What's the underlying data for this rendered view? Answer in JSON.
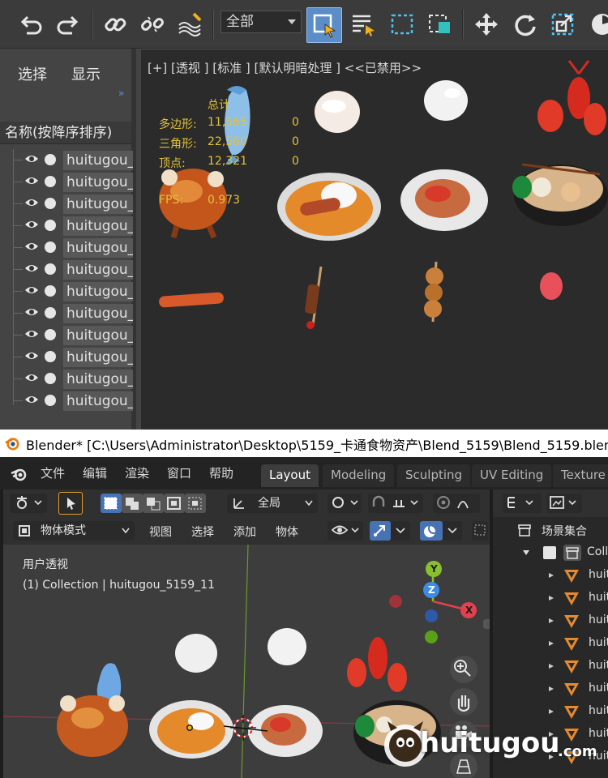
{
  "max": {
    "toolbar": {
      "scope_value": "全部"
    },
    "left_panel": {
      "menu_select": "选择",
      "menu_display": "显示",
      "collapse_glyph": "»",
      "column_header": "名称(按降序排序)",
      "items": [
        "huitugou_",
        "huitugou_",
        "huitugou_",
        "huitugou_",
        "huitugou_",
        "huitugou_",
        "huitugou_",
        "huitugou_",
        "huitugou_",
        "huitugou_",
        "huitugou_",
        "huitugou_"
      ]
    },
    "viewport": {
      "label": "[+] [透视 ] [标准 ] [默认明暗处理 ] <<已禁用>>",
      "stats": {
        "total_label": "总计",
        "polygons_label": "多边形:",
        "polygons_value": "11,565",
        "polygons_sel": "0",
        "triangles_label": "三角形:",
        "triangles_value": "22,560",
        "triangles_sel": "0",
        "vertices_label": "顶点:",
        "vertices_value": "12,321",
        "vertices_sel": "0",
        "fps_label": "FPS:",
        "fps_value": "0.973"
      }
    }
  },
  "titlebar": {
    "title": "Blender* [C:\\Users\\Administrator\\Desktop\\5159_卡通食物资产\\Blend_5159\\Blend_5159.blend]"
  },
  "blender": {
    "menus": [
      "文件",
      "编辑",
      "渲染",
      "窗口",
      "帮助"
    ],
    "workspaces": [
      "Layout",
      "Modeling",
      "Sculpting",
      "UV Editing",
      "Texture"
    ],
    "header": {
      "transform_orientation": "全局",
      "mode": "物体模式",
      "view": "视图",
      "select": "选择",
      "add": "添加",
      "object": "物体"
    },
    "viewport": {
      "view_name": "用户透视",
      "collection_info": "(1) Collection | huitugou_5159_11",
      "axis_x": "X",
      "axis_y": "Y",
      "axis_z": "Z"
    },
    "outliner": {
      "scene_collection": "场景集合",
      "collection": "Coll",
      "items": [
        "huit",
        "huit",
        "huit",
        "huit",
        "huit",
        "huit",
        "huit",
        "huit",
        "huit"
      ]
    }
  },
  "watermark": {
    "text": "huitugou",
    "suffix": ".com"
  },
  "colors": {
    "max_bg": "#444444",
    "max_viewport": "#2b2b2b",
    "stats_yellow": "#e2c23a",
    "blender_bg": "#3d3d3d",
    "blender_accent": "#4772b3",
    "mesh_orange": "#e58a2e"
  }
}
